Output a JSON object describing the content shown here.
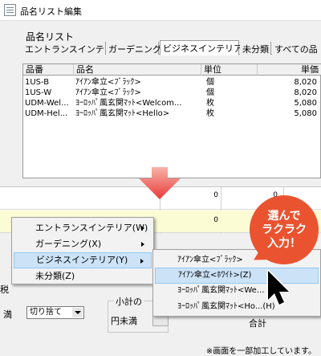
{
  "window": {
    "title": "品名リスト編集"
  },
  "list_label": "品名リスト",
  "tabs": [
    "エントランスインテリア",
    "ガーデニング",
    "ビジネスインテリア",
    "未分類",
    "すべての品"
  ],
  "table": {
    "headers": [
      "品番",
      "品名",
      "単位",
      "単価"
    ],
    "rows": [
      {
        "code": "1US-B",
        "name": "ｱｲｱﾝ傘立<ﾌﾞﾗｯｸ>",
        "unit": "個",
        "price": "8,020"
      },
      {
        "code": "1US-W",
        "name": "ｱｲｱﾝ傘立<ﾌﾞﾗｯｸ>",
        "unit": "個",
        "price": "8,020"
      },
      {
        "code": "UDM-Wel...",
        "name": "ﾖｰﾛｯﾊﾟ風玄関ﾏｯﾄ<Welcom...",
        "unit": "枚",
        "price": "5,080"
      },
      {
        "code": "UDM-Hel...",
        "name": "ﾖｰﾛｯﾊﾟ風玄関ﾏｯﾄ<Hello>",
        "unit": "枚",
        "price": "5,080"
      }
    ]
  },
  "lower_grid": {
    "zeros": [
      "0",
      "0",
      "0",
      "0"
    ]
  },
  "context_menu": {
    "items": [
      "エントランスインテリア(W)",
      "ガーデニング(X)",
      "ビジネスインテリア(Y)",
      "未分類(Z)"
    ],
    "selected_index": 2
  },
  "submenu": {
    "items": [
      "ｱｲｱﾝ傘立<ﾌﾞﾗｯｸ>",
      "ｱｲｱﾝ傘立<ﾎﾜｲﾄ>(Z)",
      "ﾖｰﾛｯﾊﾟ風玄関ﾏｯﾄ<We...",
      "ﾖｰﾛｯﾊﾟ風玄関ﾏｯﾄ<Ho...(H)"
    ],
    "selected_index": 1
  },
  "bottom": {
    "label_left_1": "税",
    "label_left_2": "満",
    "rounding_value": "切り捨て",
    "subtotal_label": "小計の",
    "yen_label": "円未満",
    "total_label": "合計"
  },
  "callout": [
    "選んで",
    "ラクラク",
    "入力！"
  ],
  "footer_note": "※画面を一部加工しています。",
  "colors": {
    "arrow": "#e83a3a",
    "bubble": "#ea5330",
    "highlight": "#cce3f7"
  }
}
